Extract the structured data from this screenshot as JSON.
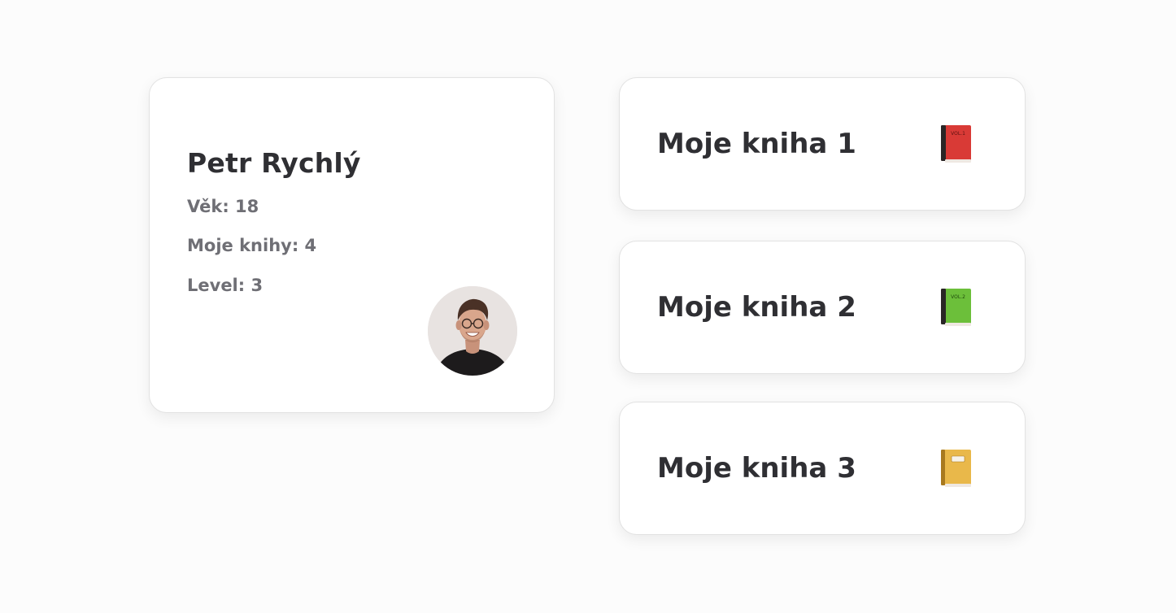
{
  "profile": {
    "name": "Petr Rychlý",
    "age_label": "Věk:",
    "age_value": "18",
    "books_label": "Moje knihy:",
    "books_value": "4",
    "level_label": "Level:",
    "level_value": "3"
  },
  "books": [
    {
      "title": "Moje kniha 1",
      "icon": "red-book-icon",
      "color": "#d93a36",
      "cover_text": "VOL.1"
    },
    {
      "title": "Moje kniha 2",
      "icon": "green-book-icon",
      "color": "#6cbf3a",
      "cover_text": "VOL.2"
    },
    {
      "title": "Moje kniha 3",
      "icon": "yellow-notebook-icon",
      "color": "#e9b84a",
      "cover_text": ""
    }
  ],
  "colors": {
    "background": "#fcfcfc",
    "card": "#ffffff",
    "text_primary": "#2f2f33",
    "text_secondary": "#6f6f75"
  }
}
